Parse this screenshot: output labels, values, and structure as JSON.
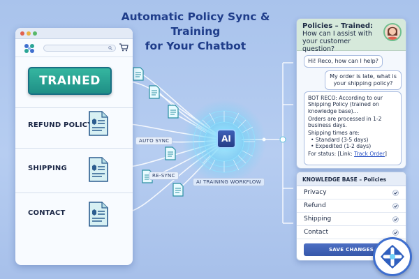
{
  "headline": {
    "line1": "Automatic Policy Sync & Training",
    "line2": "for Your Chatbot"
  },
  "website": {
    "trained_badge": "TRAINED",
    "sections": [
      "REFUND POLICY",
      "SHIPPING",
      "CONTACT"
    ]
  },
  "workflow": {
    "auto_sync": "AUTO SYNC",
    "re_sync": "RE-SYNC",
    "ai_chip": "AI",
    "training_caption": "AI TRAINING WORKFLOW"
  },
  "chat": {
    "title": "Policies – Trained:",
    "subtitle": "How can I assist with your customer question?",
    "greeting": "Hi! Reco, how can I help?",
    "user_message": "My order is late, what is your shipping policy?",
    "bot_intro": "BOT RECO: According to our Shipping Policy (trained on knowledge base)...",
    "processing": "Orders are processed in 1-2 business days.",
    "times_heading": "Shipping times are:",
    "times": [
      "• Standard (3-5 days)",
      "• Expedited (1-2 days)"
    ],
    "status_prefix": "For status: [Link: ",
    "status_link": "Track Order",
    "status_suffix": "]"
  },
  "knowledge_base": {
    "title": "KNOWLEDGE BASE – Policies",
    "items": [
      "Privacy",
      "Refund",
      "Shipping",
      "Contact"
    ],
    "save_label": "SAVE CHANGES"
  },
  "colors": {
    "accent": "#1f3d8a",
    "trained": "#2aa596",
    "glow": "#7fe3ff",
    "button": "#3f62b7"
  },
  "icons": [
    "logo-icon",
    "search-icon",
    "cart-icon",
    "document-icon",
    "check-icon",
    "avatar-icon",
    "ai-chip-icon",
    "app-logo-icon"
  ]
}
